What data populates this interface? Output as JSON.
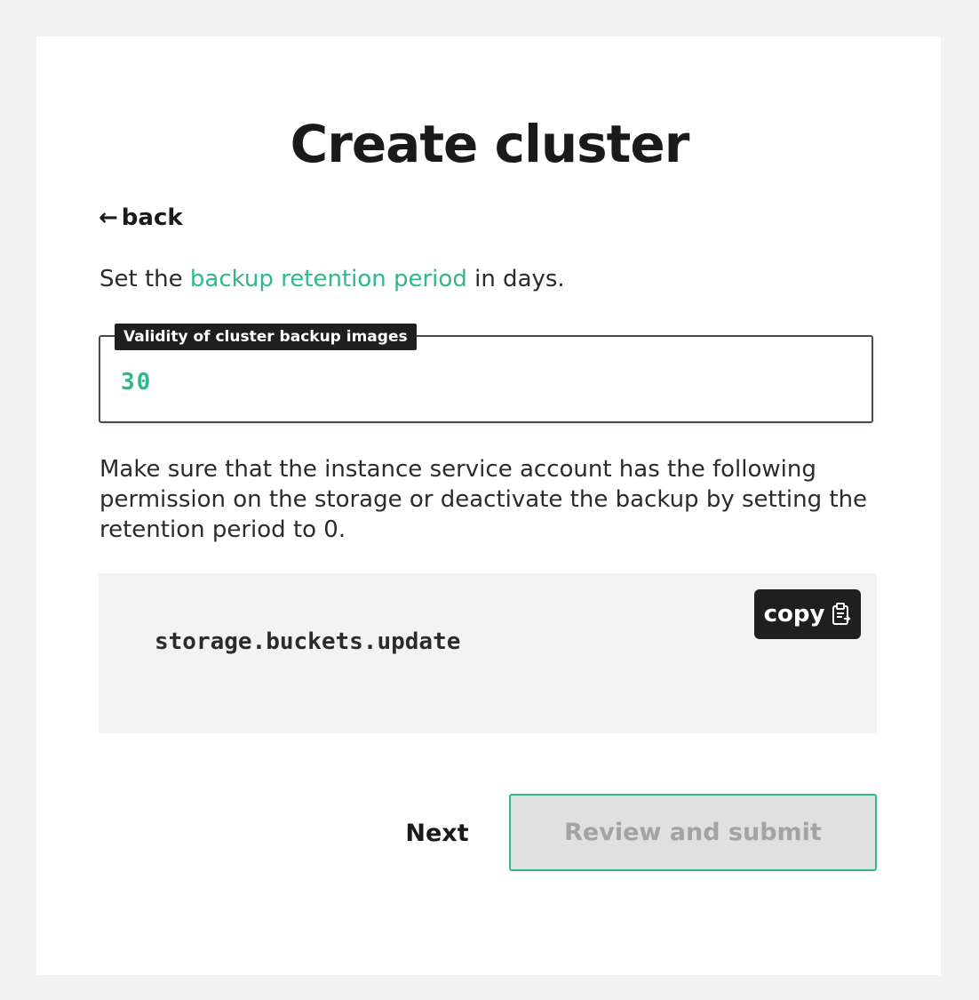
{
  "page": {
    "title": "Create cluster",
    "back_arrow": "←",
    "back_label": "back"
  },
  "instruction": {
    "prefix": "Set the ",
    "link": "backup retention period",
    "suffix": " in days."
  },
  "retention_field": {
    "label": "Validity of cluster backup images",
    "value": "30"
  },
  "note": "Make sure that the instance service account has the following permission on the storage or deactivate the backup by setting the retention period to 0.",
  "code_block": {
    "code": "storage.buckets.update",
    "copy_label": "copy",
    "copy_icon": "clipboard-icon"
  },
  "actions": {
    "next_label": "Next",
    "submit_label": "Review and submit",
    "submit_disabled": true
  },
  "colors": {
    "accent": "#2fb98a",
    "dark": "#1f1f1f",
    "background": "#f2f2f2"
  }
}
